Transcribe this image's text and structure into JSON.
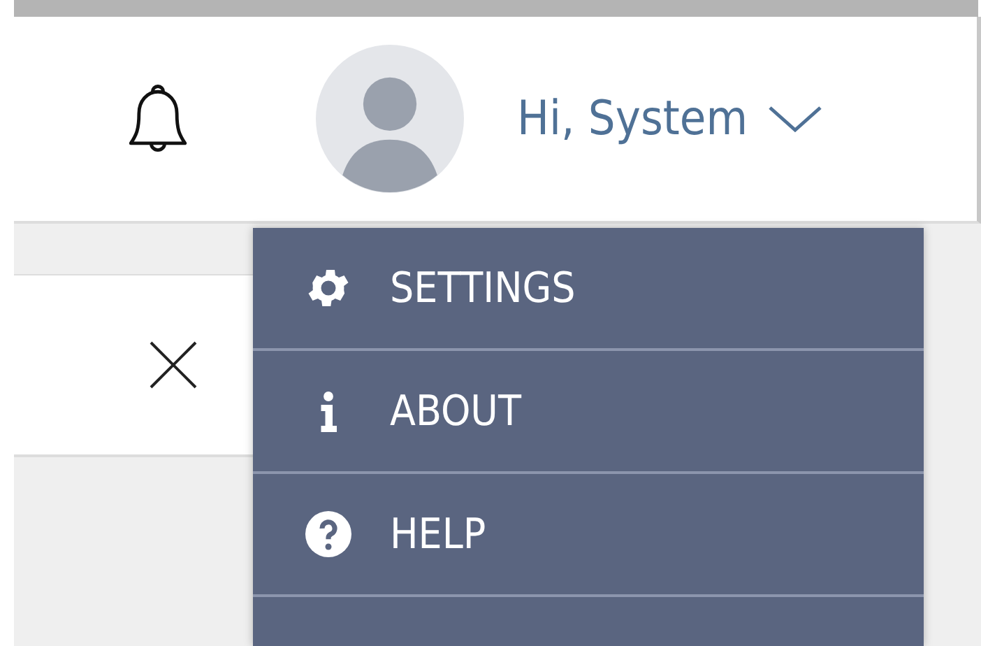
{
  "header": {
    "greeting": "Hi, System",
    "menu_expanded": true
  },
  "menu": [
    {
      "label": "SETTINGS",
      "kind": "settings"
    },
    {
      "label": "ABOUT",
      "kind": "info"
    },
    {
      "label": "HELP",
      "kind": "help"
    }
  ]
}
